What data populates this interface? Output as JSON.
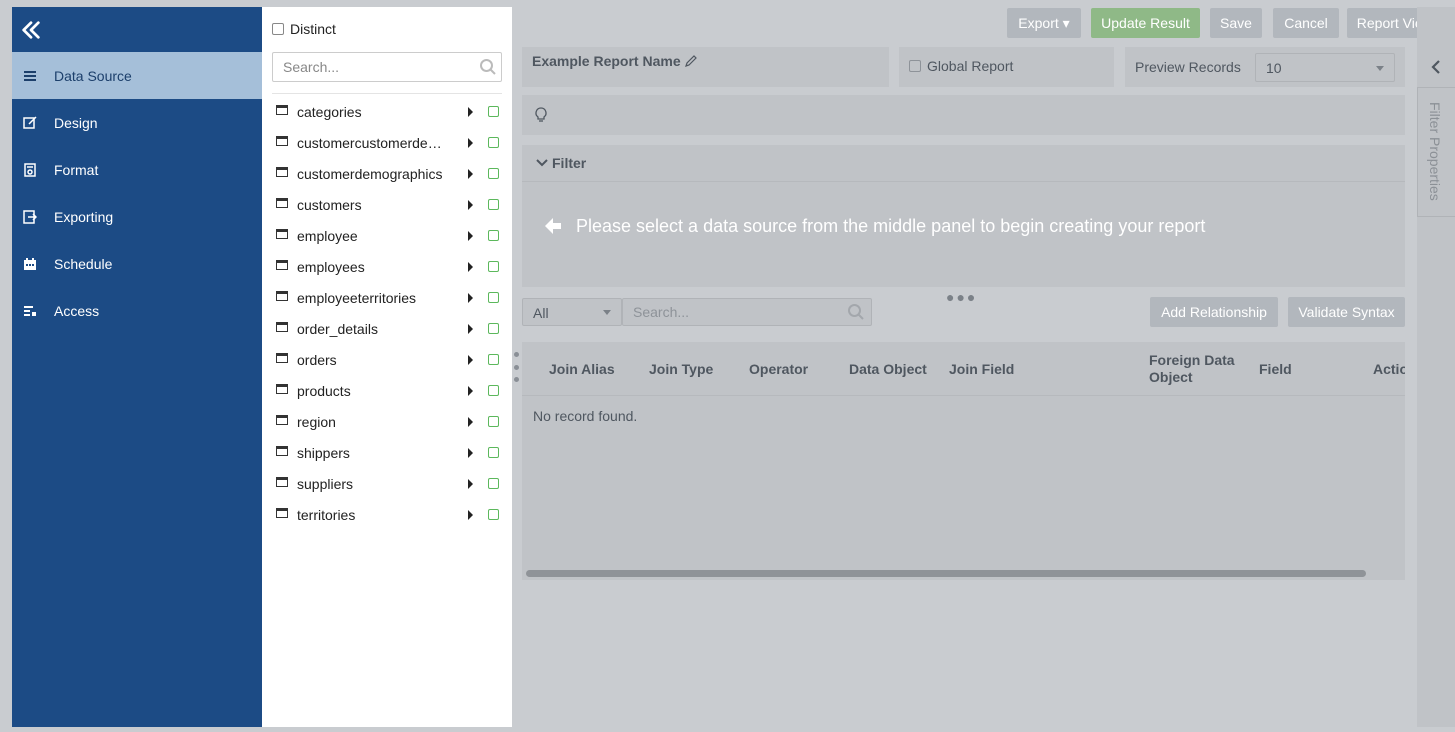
{
  "nav": {
    "items": [
      {
        "label": "Data Source",
        "icon": "list-icon"
      },
      {
        "label": "Design",
        "icon": "edit-icon"
      },
      {
        "label": "Format",
        "icon": "format-icon"
      },
      {
        "label": "Exporting",
        "icon": "export-icon"
      },
      {
        "label": "Schedule",
        "icon": "calendar-icon"
      },
      {
        "label": "Access",
        "icon": "access-icon"
      }
    ]
  },
  "datasource": {
    "distinct_label": "Distinct",
    "search_placeholder": "Search...",
    "tables": [
      "categories",
      "customercustomerdemo",
      "customerdemographics",
      "customers",
      "employee",
      "employees",
      "employeeterritories",
      "order_details",
      "orders",
      "products",
      "region",
      "shippers",
      "suppliers",
      "territories"
    ]
  },
  "toolbar": {
    "export": "Export ▾",
    "update_result": "Update Result",
    "save": "Save",
    "cancel": "Cancel",
    "report_viewer": "Report Viewer"
  },
  "report": {
    "name": "Example Report Name",
    "global_label": "Global Report",
    "preview_label": "Preview Records",
    "preview_value": "10"
  },
  "filter": {
    "title": "Filter",
    "message": "Please select a data source from the middle panel to begin creating your report"
  },
  "relationships": {
    "filter_value": "All",
    "search_placeholder": "Search...",
    "add_relationship": "Add Relationship",
    "validate_syntax": "Validate Syntax",
    "columns": [
      "Join Alias",
      "Join Type",
      "Operator",
      "Data Object",
      "Join Field",
      "Foreign Data Object",
      "Field",
      "Actio"
    ],
    "empty": "No record found."
  },
  "side_panel": {
    "label": "Filter Properties"
  },
  "colors": {
    "nav_bg": "#1c4b85",
    "nav_active": "#a5bfd9",
    "overlay": "#c9ccd0",
    "success": "#5cb85c"
  }
}
